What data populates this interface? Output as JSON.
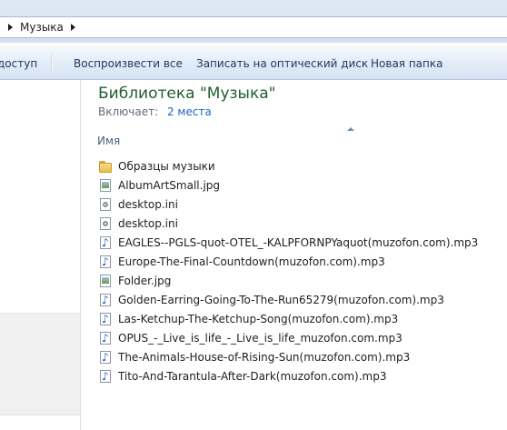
{
  "address_bar": {
    "crumb": "Музыка"
  },
  "toolbar": {
    "items": [
      "доступ",
      "Воспроизвести все",
      "Записать на оптический диск",
      "Новая папка"
    ]
  },
  "library": {
    "title": "Библиотека \"Музыка\"",
    "includes_label": "Включает:",
    "includes_link": "2 места"
  },
  "columns": {
    "name": "Имя"
  },
  "files": [
    {
      "name": "Образцы музыки",
      "icon": "folder-icon"
    },
    {
      "name": "AlbumArtSmall.jpg",
      "icon": "image-file-icon"
    },
    {
      "name": "desktop.ini",
      "icon": "settings-file-icon"
    },
    {
      "name": "desktop.ini",
      "icon": "settings-file-icon"
    },
    {
      "name": "EAGLES--PGLS-quot-OTEL_-KALPFORNPYaquot(muzofon.com).mp3",
      "icon": "audio-file-icon"
    },
    {
      "name": "Europe-The-Final-Countdown(muzofon.com).mp3",
      "icon": "audio-file-icon"
    },
    {
      "name": "Folder.jpg",
      "icon": "image-file-icon"
    },
    {
      "name": "Golden-Earring-Going-To-The-Run65279(muzofon.com).mp3",
      "icon": "audio-file-icon"
    },
    {
      "name": "Las-Ketchup-The-Ketchup-Song(muzofon.com).mp3",
      "icon": "audio-file-icon"
    },
    {
      "name": "OPUS_-_Live_is_life_-_Live_is_life_muzofon.com.mp3",
      "icon": "audio-file-icon"
    },
    {
      "name": "The-Animals-House-of-Rising-Sun(muzofon.com).mp3",
      "icon": "audio-file-icon"
    },
    {
      "name": "Tito-And-Tarantula-After-Dark(muzofon.com).mp3",
      "icon": "audio-file-icon"
    }
  ],
  "colors": {
    "title_green": "#1e5e2f",
    "link_blue": "#1a66c4",
    "toolbar_text": "#1e395b"
  }
}
